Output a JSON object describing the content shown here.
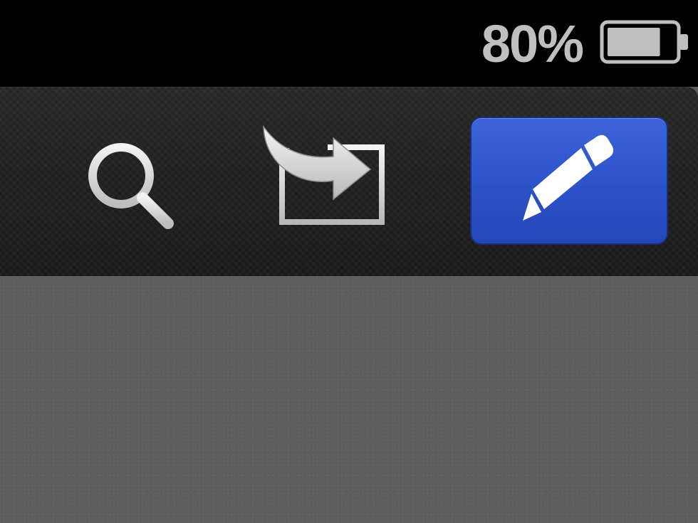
{
  "status_bar": {
    "battery_percent": "80%",
    "battery_level": 0.8,
    "battery_icon": "battery-icon"
  },
  "toolbar": {
    "buttons": [
      {
        "name": "search",
        "icon": "search-icon"
      },
      {
        "name": "share",
        "icon": "share-icon"
      },
      {
        "name": "edit",
        "icon": "pencil-icon",
        "active": true
      }
    ]
  },
  "colors": {
    "status_bar_bg": "#000000",
    "toolbar_bg": "#1f1f1f",
    "icon_color": "#d6d6d6",
    "edit_button_bg": "#2f55cc",
    "content_bg": "#5f5f5f"
  }
}
